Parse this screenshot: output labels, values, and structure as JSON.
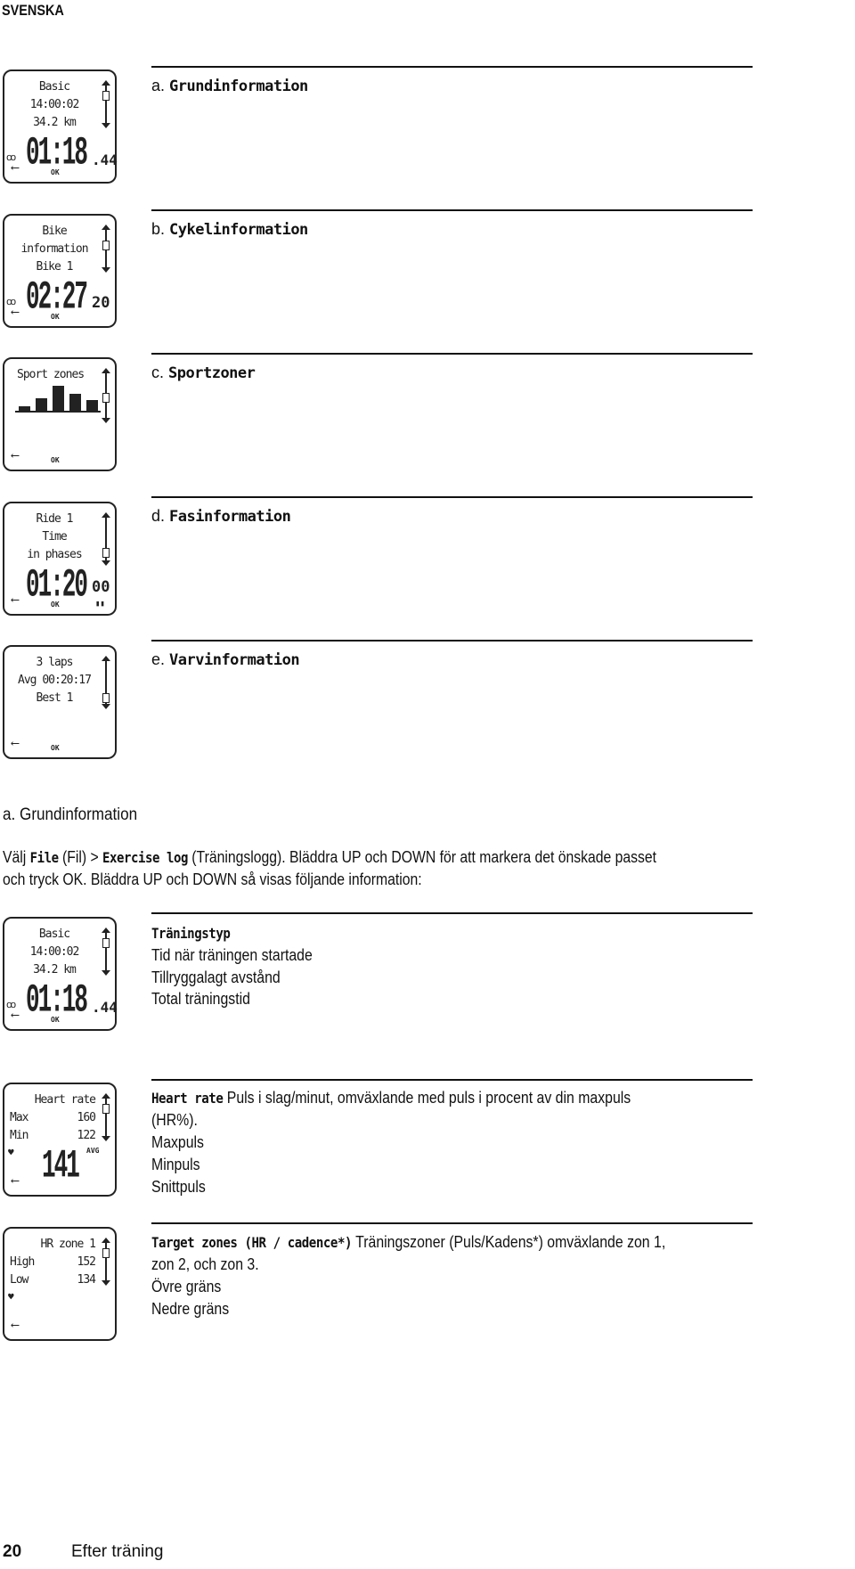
{
  "header": {
    "language": "SVENSKA"
  },
  "overview": [
    {
      "letter": "a.",
      "title": "Grundinformation"
    },
    {
      "letter": "b.",
      "title": "Cykelinformation"
    },
    {
      "letter": "c.",
      "title": "Sportzoner"
    },
    {
      "letter": "d.",
      "title": "Fasinformation"
    },
    {
      "letter": "e.",
      "title": "Varvinformation"
    }
  ],
  "screens": {
    "basic": {
      "l1": "Basic",
      "l2": "14:00:02",
      "l3": "34.2 km",
      "big": "01:18",
      "small": ".44",
      "ok": "OK"
    },
    "bike": {
      "l1": "Bike",
      "l2": "information",
      "l3": "Bike 1",
      "big": "02:27",
      "small": "20",
      "ok": "OK"
    },
    "sport": {
      "l1": "Sport zones",
      "ok": "OK",
      "zones": [
        1,
        3,
        6,
        4,
        2.5
      ]
    },
    "phase": {
      "l1": "Ride 1",
      "l2": "Time",
      "l3": "in phases",
      "big": "01:20",
      "small": "00",
      "ok": "OK"
    },
    "laps": {
      "l1": "3 laps",
      "l2": "Avg 00:20:17",
      "l3": "Best 1",
      "ok": "OK"
    },
    "hr": {
      "l1": "Heart rate",
      "max_label": "Max",
      "max": "160",
      "min_label": "Min",
      "min": "122",
      "big": "141",
      "avg": "AVG"
    },
    "zone": {
      "l1": "HR zone 1",
      "high_label": "High",
      "high": "152",
      "low_label": "Low",
      "low": "134"
    }
  },
  "section": {
    "heading": "a. Grundinformation",
    "para1_a": "Välj ",
    "file": "File",
    "para1_b": " (Fil) > ",
    "log": "Exercise log",
    "para1_c": " (Träningslogg). Bläddra UP och DOWN för att markera det önskade passet",
    "para2": "och tryck OK. Bläddra UP och DOWN så visas följande information:"
  },
  "items": [
    {
      "term": "Träningstyp",
      "lines": [
        "Tid när träningen startade",
        "Tillryggalagt avstånd",
        "Total träningstid"
      ]
    },
    {
      "term": "Heart rate",
      "desc": " Puls i slag/minut, omväxlande med puls i procent av din maxpuls",
      "cont": "(HR%).",
      "lines": [
        "Maxpuls",
        "Minpuls",
        "Snittpuls"
      ]
    },
    {
      "term": "Target zones (HR / cadence*)",
      "desc": " Träningszoner (Puls/Kadens*) omväxlande zon 1,",
      "cont": "zon 2, och zon 3.",
      "lines": [
        "Övre gräns",
        "Nedre gräns"
      ]
    }
  ],
  "footer": {
    "page": "20",
    "chapter": "Efter träning"
  },
  "icons": {
    "bike": "bike-icon",
    "heart": "heart-icon",
    "back": "back-arrow-icon",
    "phases": "phases-icon"
  }
}
